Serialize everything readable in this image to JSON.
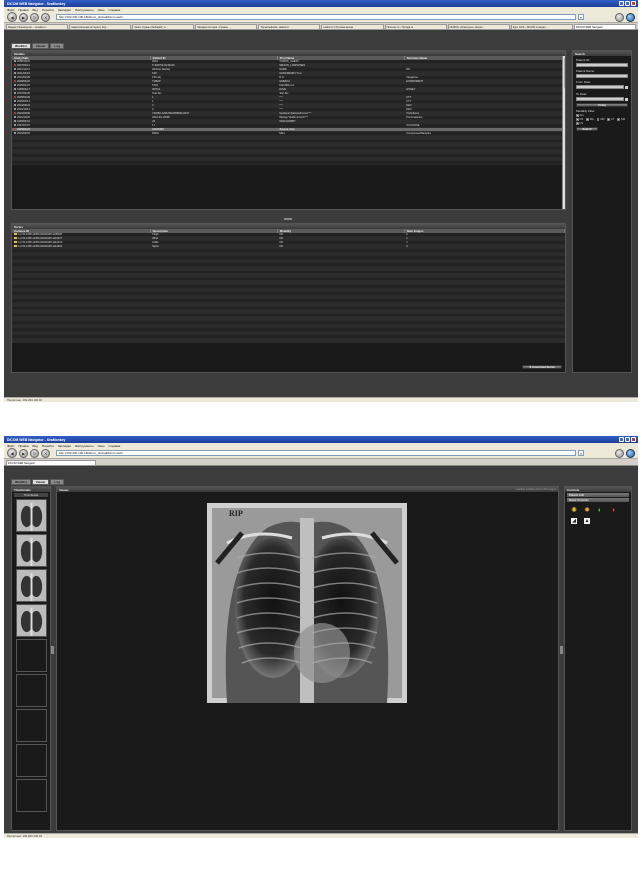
{
  "browser": {
    "title": "DICOM WEB Navigator - SeaMonkey",
    "menu": [
      "Файл",
      "Правка",
      "Вид",
      "Перейти",
      "Закладки",
      "Инструменты",
      "Окно",
      "Справка"
    ],
    "url_1": "http://192.200.100.18/dicom_shimal/dicom-web/",
    "url_2": "http://192.200.100.18/dicom_shimal/dicom-web/",
    "tabs_1": [
      "Яндекс.Переводчик – онлайн-п...",
      "замечательная история | Кор...",
      "Книги страны Любовей | н...",
      "Загадка истории. Страны ...",
      "Тремольфизм. Новости",
      "Новости | Русская весна",
      "Прогноз.ru - Погода.ru",
      "ИНФОК «Электрон» запуск...",
      "Курс ACS - DICOM станция ...",
      "DICOM WEB Navigator"
    ],
    "tabs_2": [
      "DICOM WEB Navigator"
    ],
    "status_1": "Прочитано: 192.200.100.18",
    "status_2": "Прочитано: 192.200.100.18"
  },
  "screen1": {
    "app_tabs": [
      "Worklist",
      "Viewer",
      "Log"
    ],
    "studies": {
      "title": "Studies",
      "columns": [
        "Study Date",
        "Patient ID",
        "First Name",
        "Surname Name"
      ],
      "rows": [
        [
          "2008/10/31",
          "0001",
          "TOMOS_CHEST",
          ""
        ],
        [
          "2007/04/11",
          "P-20070411130126",
          "SMOUR_LOWSOSES",
          ""
        ],
        [
          "2010/12/14",
          "Webnet Display",
          "NAME",
          "RD"
        ],
        [
          "2011/02/16",
          "K30",
          "SOROMENKO S.G.",
          ""
        ],
        [
          "2010/03/25",
          "F15 obj",
          "D.O.",
          "Vergacina"
        ],
        [
          "2009/03/22",
          "TUBAP",
          "SOBAKA",
          "EXPERIMENT"
        ],
        [
          "2005/01/07",
          "5736",
          "FAKOBA V.A.",
          ""
        ],
        [
          "1998/04/17",
          "007DA",
          "DAVE",
          "HONEY"
        ],
        [
          "2007/04/05",
          "Test-Sic",
          "Test-Sic",
          ""
        ],
        [
          "2005/03/30",
          "1",
          "\"\"\"\"",
          "KTT"
        ],
        [
          "2005/03/14",
          "1",
          "\"\"\"\"",
          "KTT"
        ],
        [
          "2004/09/23",
          "3",
          "\"\"\"\"",
          "MAV"
        ],
        [
          "2004/10/14",
          "2",
          "\"\"\"\"",
          "MAV"
        ],
        [
          "2010/09/06",
          "722050-1295-501095881111517",
          "Svetlana^Aleksandrovna^^^",
          "Trubnikova"
        ],
        [
          "2010/10/25",
          "2010-09-10055",
          "Nikolay^Vladimirovich^^^",
          "Ponomarenko"
        ],
        [
          "1995/04/01",
          "22",
          "VASCHOMBY",
          ""
        ],
        [
          "1997/07/07",
          "17",
          "",
          "SCOLIOSE"
        ],
        [
          "2003/04/22",
          "19971950",
          "Trauma, Polo",
          ""
        ],
        [
          "2004/09/26",
          "DMIG",
          "MG1",
          "CompressedSamples"
        ]
      ],
      "selected_row": 17
    },
    "series": {
      "title": "Series",
      "columns": [
        "Instance ID",
        "Description",
        "Modality",
        "Num Images"
      ],
      "rows": [
        [
          "1.2.51.3155.11350.20020425.1105947",
          "Thigh",
          "CR",
          "2"
        ],
        [
          "1.2.51.3155.11350.20020425.1110027",
          "Wrist",
          "CR",
          "1"
        ],
        [
          "1.2.51.3155.11350.20020425.1112210",
          "Ankle",
          "CR",
          "1"
        ],
        [
          "1.2.51.3155.11350.20020425.1112904",
          "Spine",
          "CR",
          "3"
        ]
      ],
      "download_label": "Download Series"
    },
    "search": {
      "title": "Search",
      "patient_id_label": "Patient ID:",
      "patient_name_label": "Patient Name:",
      "from_date_label": "From Date:",
      "to_date_label": "To Date:",
      "today_label": "Today",
      "modality_label": "Modality Filter",
      "modalities": [
        "ALL",
        "CR",
        "MG",
        "MR",
        "CT",
        "NM",
        "US"
      ],
      "search_label": "Search"
    }
  },
  "screen2": {
    "app_tabs": [
      "Worklist",
      "Viewer",
      "Log"
    ],
    "thumbnails_title": "Thumbnails",
    "thumbnails_header": "Thumbnails",
    "viewer_title": "Viewer",
    "viewer_status": "Loading working set for 4th images",
    "xray_marker": "RIP",
    "controls_title": "Controls",
    "patient_info_label": "Patient Info",
    "basic_controls_label": "Basic Controls"
  }
}
